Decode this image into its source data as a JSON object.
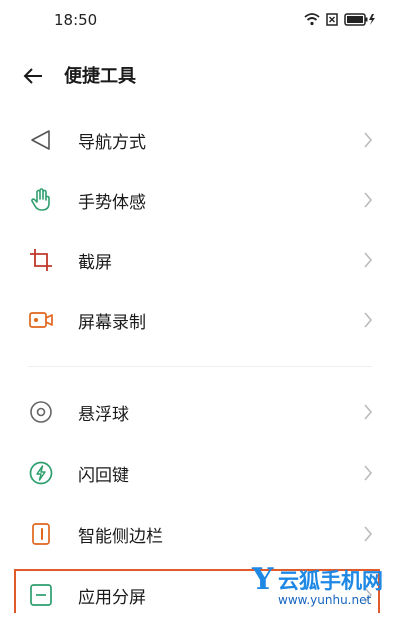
{
  "status_bar": {
    "time": "18:50",
    "icons": [
      "wifi-icon",
      "sim-icon",
      "battery-charging-icon"
    ]
  },
  "header": {
    "title": "便捷工具",
    "back_icon": "arrow-left-icon"
  },
  "items": [
    {
      "label": "导航方式",
      "icon": "navigation-triangle-icon",
      "color": "#555555"
    },
    {
      "label": "手势体感",
      "icon": "hand-icon",
      "color": "#2e9e6e"
    },
    {
      "label": "截屏",
      "icon": "crop-icon",
      "color": "#c0392b"
    },
    {
      "label": "屏幕录制",
      "icon": "video-camera-icon",
      "color": "#e0661e"
    },
    {
      "label": "悬浮球",
      "icon": "floating-ball-icon",
      "color": "#666666"
    },
    {
      "label": "闪回键",
      "icon": "flash-bolt-icon",
      "color": "#2e9e6e"
    },
    {
      "label": "智能侧边栏",
      "icon": "sidebar-icon",
      "color": "#e0661e"
    },
    {
      "label": "应用分屏",
      "icon": "split-screen-icon",
      "color": "#2e9e6e"
    }
  ],
  "watermark": {
    "brand": "云狐手机网",
    "url": "www.yunhu.net",
    "color": "#1e88e5"
  },
  "highlight_color": "#e05a2b"
}
